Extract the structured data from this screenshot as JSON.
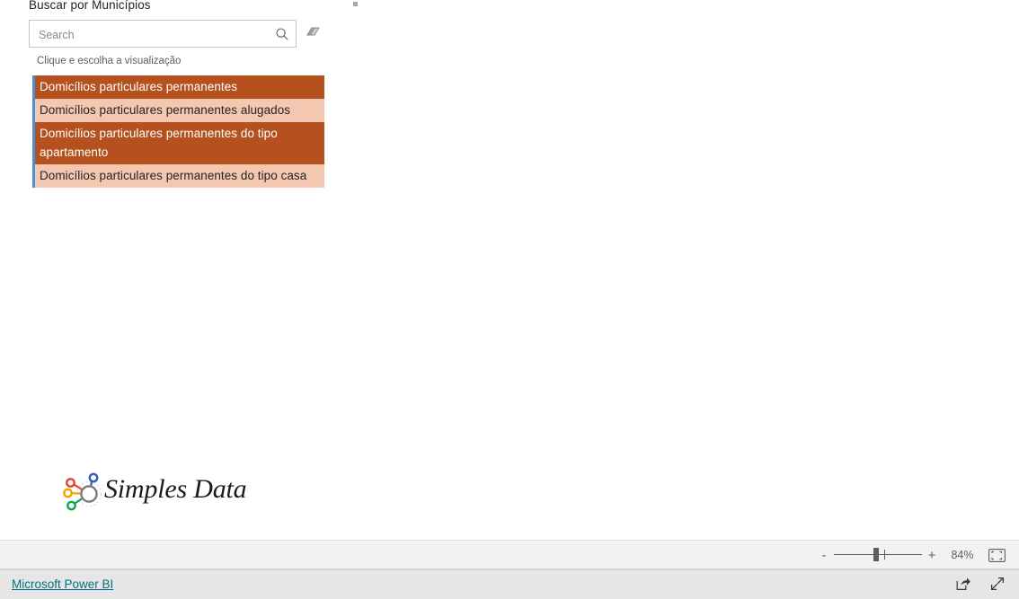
{
  "report": {
    "slicer": {
      "title": "Buscar por Municípios",
      "hint": "Clique e escolha a visualização",
      "search": {
        "placeholder": "Search",
        "value": "",
        "search_icon": "search-icon",
        "clear_icon": "eraser-icon"
      },
      "items": [
        {
          "label": "Domicílios particulares permanentes",
          "selected": true
        },
        {
          "label": "Domicílios particulares permanentes alugados",
          "selected": false
        },
        {
          "label": "Domicílios particulares permanentes do tipo apartamento",
          "selected": true
        },
        {
          "label": "Domicílios particulares permanentes do tipo casa",
          "selected": false
        }
      ],
      "colors": {
        "selected_background": "#b4511f",
        "selected_text": "#ffffff",
        "unselected_background": "#f4c7b0",
        "unselected_text": "#252423",
        "focus_border": "#4a90d9"
      }
    },
    "logo": {
      "text": "Simples Data",
      "mark_icon": "network-nodes-icon",
      "node_colors": {
        "hub": "#7a7a7a",
        "top": "#2b5fc4",
        "upper_left": "#e8402a",
        "left": "#f0a500",
        "lower_left": "#13a155"
      }
    }
  },
  "status_bar": {
    "zoom_out_label": "-",
    "zoom_in_label": "+",
    "zoom_level": "84%",
    "zoom_slider_percent": 45,
    "fit_page_icon": "fit-to-page-icon"
  },
  "footer": {
    "brand_link": "Microsoft Power BI",
    "brand_link_color": "#00727e",
    "actions": [
      {
        "name": "share-icon",
        "label": "Share"
      },
      {
        "name": "fullscreen-icon",
        "label": "Full screen"
      }
    ]
  }
}
